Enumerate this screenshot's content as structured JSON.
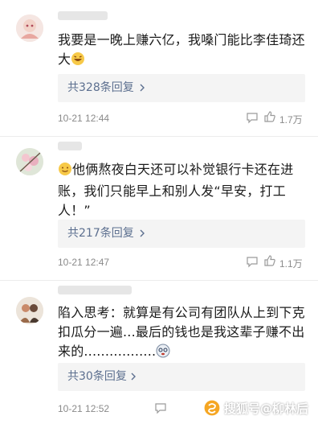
{
  "comments": [
    {
      "text": "我要是一晚上赚六亿，我嗓门能比李佳琦还大",
      "reply_label": "共328条回复",
      "time": "10-21 12:44",
      "likes": "1.7万"
    },
    {
      "text": "他俩熬夜白天还可以补觉银行卡还在进账，我们只能早上和别人发“早安，打工人！”",
      "reply_label": "共217条回复",
      "time": "10-21 12:47",
      "likes": "1.1万"
    },
    {
      "text": "陷入思考：就算是有公司有团队从上到下克扣瓜分一遍...最后的钱也是我这辈子赚不出来的.................",
      "reply_label": "共30条回复",
      "time": "10-21 12:52",
      "likes": ""
    }
  ],
  "watermark": {
    "text": "搜狐号@柳林后"
  },
  "colors": {
    "reply_link": "#5c6f8f",
    "meta_grey": "#8a8a8a",
    "reply_bg": "#f4f4f4"
  },
  "icons": [
    "avatar-anime",
    "avatar-blossom",
    "avatar-couple",
    "chevron-right-icon",
    "comment-icon",
    "thumb-up-icon",
    "sohu-logo-icon",
    "emoji-laugh",
    "emoji-smile",
    "emoji-dizzy"
  ]
}
